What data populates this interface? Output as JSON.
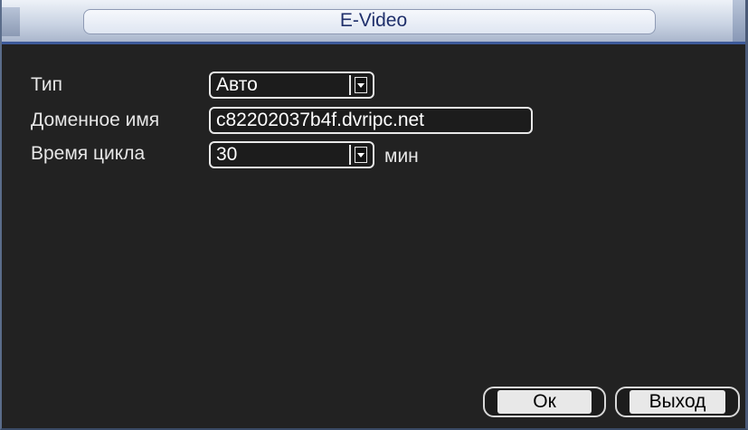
{
  "window": {
    "title": "E-Video"
  },
  "form": {
    "type": {
      "label": "Тип",
      "value": "Авто"
    },
    "domain": {
      "label": "Доменное имя",
      "value": "c82202037b4f.dvripc.net"
    },
    "cycle": {
      "label": "Время цикла",
      "value": "30",
      "unit": "мин"
    }
  },
  "buttons": {
    "ok": "Ок",
    "exit": "Выход"
  },
  "colors": {
    "background": "#222222",
    "title_text": "#1f2f6b",
    "title_bar": "#c8d2e2",
    "title_underline": "#3d5a9a",
    "field_border": "#e8e8e8",
    "button_face": "#e8e8e8"
  },
  "icons": {
    "dropdown": "chevron-down-icon"
  }
}
